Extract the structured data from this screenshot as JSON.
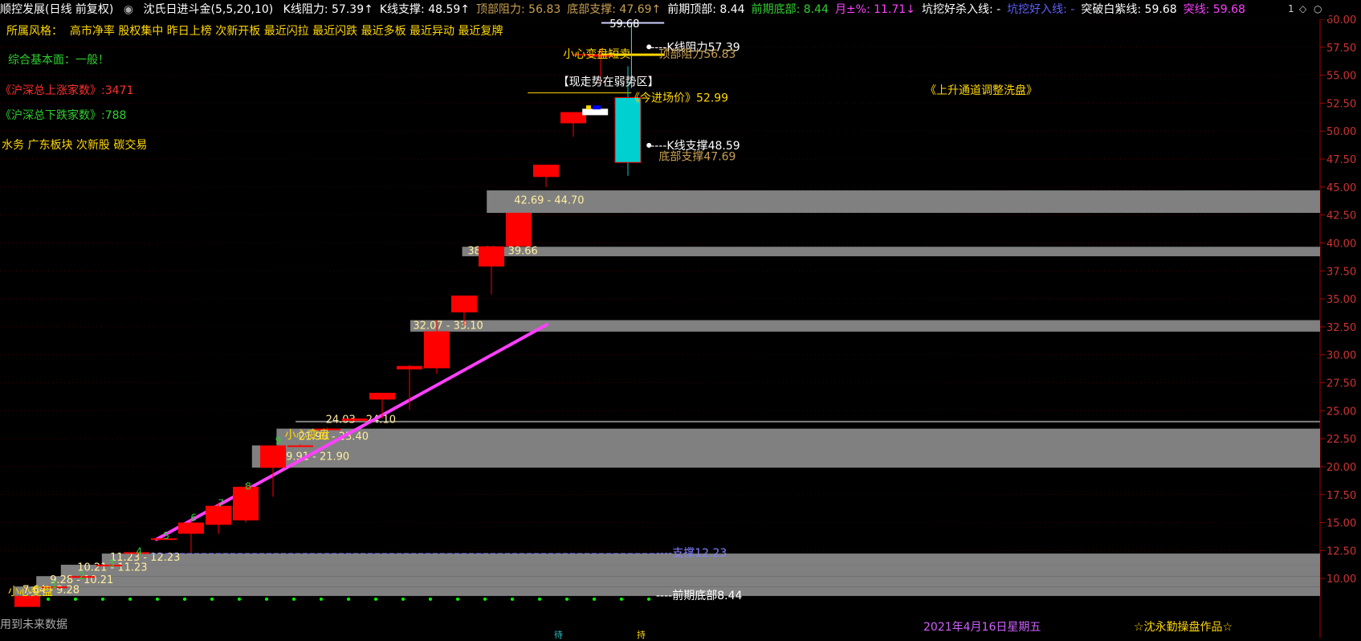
{
  "header": {
    "app_title": "顺控发展(日线 前复权)",
    "indicator_name": "沈氏日进斗金(5,5,20,10)",
    "items": [
      {
        "label": "K线阻力:",
        "value": "57.39",
        "arrow": "↑",
        "color": "#ffffff"
      },
      {
        "label": "K线支撑:",
        "value": "48.59",
        "arrow": "↑",
        "color": "#ffffff"
      },
      {
        "label": "顶部阻力:",
        "value": "56.83",
        "arrow": "",
        "color": "#c8a050"
      },
      {
        "label": "底部支撑:",
        "value": "47.69",
        "arrow": "↑",
        "color": "#c8a050"
      },
      {
        "label": "前期顶部:",
        "value": "8.44",
        "arrow": "",
        "color": "#ffffff"
      },
      {
        "label": "前期底部:",
        "value": "8.44",
        "arrow": "",
        "color": "#30d030"
      },
      {
        "label": "月±%:",
        "value": "11.71",
        "arrow": "↓",
        "color": "#ff40ff"
      },
      {
        "label": "坑挖好杀入线:",
        "value": "-",
        "arrow": "",
        "color": "#ffffff"
      },
      {
        "label": "坑挖好入线:",
        "value": "-",
        "arrow": "",
        "color": "#6060ff"
      },
      {
        "label": "突破白紫线:",
        "value": "59.68",
        "arrow": "",
        "color": "#ffffff"
      },
      {
        "label": "突线:",
        "value": "59.68",
        "arrow": "",
        "color": "#ff40ff"
      }
    ],
    "controls": [
      "1",
      "◇",
      "○"
    ]
  },
  "info_panel": {
    "style_label": "所属风格：",
    "style_tags": "高市净率 股权集中 昨日上榜 次新开板 最近闪拉 最近闪跌 最近多板 最近异动 最近复牌",
    "fundamental": "综合基本面：一般！",
    "up_count_text": "《沪深总上涨家数》:3471",
    "down_count_text": "《沪深总下跌家数》:788",
    "sectors": "水务 广东板块 次新股 碳交易"
  },
  "annotations": {
    "weak_zone": "【现走势在弱势区】",
    "entry_price": "《今进场价》52.99",
    "trend_note": "《上升通道调整洗盘》",
    "k_resistance": "----K线阻力57.39",
    "k_support": "----K线支撑48.59",
    "top_resistance": "顶部阻力56.83",
    "bottom_support": "底部支撑47.69",
    "careful_short": "小心变盘短卖",
    "careful_1": "小心变盘",
    "careful_2": "小心变盘",
    "support_line": "----支撑12.23",
    "prev_bottom": "----前期底部8.44",
    "top_label": "59.68",
    "top_label_2": "突破白紫线59.68",
    "future_data": "用到未来数据",
    "date": "2021年4月16日星期五",
    "credit": "☆沈永勤操盘作品☆",
    "bottom_mark_1": "待",
    "bottom_mark_2": "持"
  },
  "chart_data": {
    "type": "candlestick",
    "y_axis": {
      "min": 7.5,
      "max": 60,
      "ticks": [
        "60.00",
        "57.50",
        "55.00",
        "52.50",
        "50.00",
        "47.50",
        "45.00",
        "42.50",
        "40.00",
        "37.50",
        "35.00",
        "32.50",
        "30.00",
        "27.50",
        "25.00",
        "22.50",
        "20.00",
        "17.50",
        "15.00",
        "12.50",
        "10.00"
      ]
    },
    "candles": [
      {
        "open": 7.46,
        "close": 8.44,
        "high": 8.44,
        "low": 7.46,
        "color": "red"
      },
      {
        "open": 9.28,
        "close": 9.28,
        "high": 9.28,
        "low": 9.28,
        "color": "red"
      },
      {
        "open": 10.21,
        "close": 10.21,
        "high": 10.21,
        "low": 10.21,
        "color": "red"
      },
      {
        "open": 11.23,
        "close": 11.23,
        "high": 11.23,
        "low": 11.23,
        "color": "red"
      },
      {
        "open": 12.35,
        "close": 12.35,
        "high": 12.35,
        "low": 12.35,
        "color": "red"
      },
      {
        "open": 13.59,
        "close": 13.59,
        "high": 13.6,
        "low": 13.5,
        "color": "red"
      },
      {
        "open": 14.0,
        "close": 15.0,
        "high": 15.2,
        "low": 12.3,
        "color": "red"
      },
      {
        "open": 14.8,
        "close": 16.5,
        "high": 16.8,
        "low": 14.0,
        "color": "red"
      },
      {
        "open": 15.2,
        "close": 18.2,
        "high": 18.5,
        "low": 15.0,
        "color": "red"
      },
      {
        "open": 19.9,
        "close": 21.9,
        "high": 21.9,
        "low": 17.3,
        "color": "red"
      },
      {
        "open": 21.9,
        "close": 21.9,
        "high": 22.0,
        "low": 21.8,
        "color": "red"
      },
      {
        "open": 23.4,
        "close": 23.4,
        "high": 23.5,
        "low": 23.3,
        "color": "red"
      },
      {
        "open": 24.1,
        "close": 24.3,
        "high": 24.4,
        "low": 24.0,
        "color": "red"
      },
      {
        "open": 26.0,
        "close": 26.6,
        "high": 26.6,
        "low": 24.3,
        "color": "red"
      },
      {
        "open": 28.7,
        "close": 29.0,
        "high": 29.1,
        "low": 25.1,
        "color": "red"
      },
      {
        "open": 28.8,
        "close": 32.1,
        "high": 33.1,
        "low": 28.3,
        "color": "red"
      },
      {
        "open": 33.8,
        "close": 35.3,
        "high": 35.3,
        "low": 32.6,
        "color": "red"
      },
      {
        "open": 37.9,
        "close": 39.7,
        "high": 39.7,
        "low": 35.4,
        "color": "red"
      },
      {
        "open": 39.7,
        "close": 42.7,
        "high": 42.7,
        "low": 40.5,
        "color": "red"
      },
      {
        "open": 45.9,
        "close": 47.0,
        "high": 47.0,
        "low": 45.0,
        "color": "red"
      },
      {
        "open": 50.7,
        "close": 51.7,
        "high": 51.7,
        "low": 49.5,
        "color": "red"
      },
      {
        "open": 56.8,
        "close": 56.8,
        "high": 57.4,
        "low": 54.2,
        "color": "red"
      },
      {
        "open": 53.0,
        "close": 47.2,
        "high": 55.8,
        "low": 46.0,
        "color": "cyan"
      }
    ],
    "price_ranges": [
      "42.69 - 44.70",
      "38.81 - 39.66",
      "32.07 - 33.10",
      "24.03 - 24.10",
      "21.90 - 23.40",
      "19.91 - 21.90",
      "11.23 - 12.23",
      "10.21 - 11.23",
      "9.28 - 10.21",
      "7.64 - 9.28"
    ],
    "bands": [
      {
        "from": 42.69,
        "to": 44.7
      },
      {
        "from": 38.81,
        "to": 39.66
      },
      {
        "from": 32.07,
        "to": 33.1
      },
      {
        "from": 24.03,
        "to": 24.1
      },
      {
        "from": 21.9,
        "to": 23.4
      },
      {
        "from": 19.91,
        "to": 21.9
      },
      {
        "from": 11.23,
        "to": 12.23
      },
      {
        "from": 10.21,
        "to": 11.23
      },
      {
        "from": 9.28,
        "to": 10.21
      },
      {
        "from": 8.44,
        "to": 9.28
      }
    ],
    "trend_line": {
      "from": 13.5,
      "to": 32.7
    },
    "step_numbers": [
      "1",
      "2",
      "3",
      "4",
      "5",
      "6",
      "7",
      "8",
      "9"
    ],
    "levels": {
      "k_resistance": 57.39,
      "k_support": 48.59,
      "top_resistance": 56.83,
      "bottom_support": 47.69,
      "entry_price": 52.99,
      "support": 12.23,
      "prev_bottom": 8.44,
      "breakout": 59.68
    }
  }
}
